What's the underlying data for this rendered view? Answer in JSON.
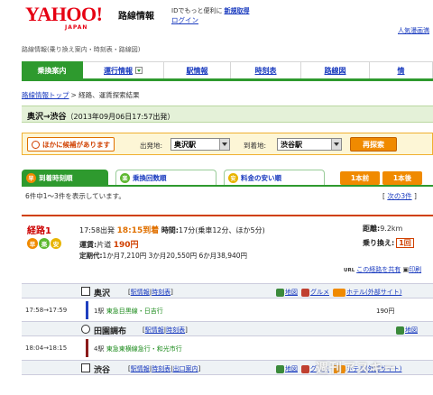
{
  "header": {
    "logo": "YAHOO!",
    "logo_sub": "JAPAN",
    "service": "路線情報",
    "id_text": "IDでもっと便利に",
    "register": "新規取得",
    "login": "ログイン",
    "popular": "人気漫画満"
  },
  "breadcrumb_top": "路線情報(乗り換え案内・時刻表・路線図)",
  "nav": {
    "tabs": [
      {
        "label": "乗換案内",
        "active": true
      },
      {
        "label": "運行情報",
        "dropdown": true
      },
      {
        "label": "駅情報"
      },
      {
        "label": "時刻表"
      },
      {
        "label": "路線図"
      },
      {
        "label": "情"
      }
    ]
  },
  "crumbs": {
    "link": "路線情報トップ",
    "rest": "> 経路、運賃探索結果"
  },
  "route_title": {
    "route": "奥沢→渋谷",
    "date": "（2013年09月06日17:57出発）"
  },
  "search": {
    "alt_badge": "ほかに候補があります",
    "from_label": "出発地:",
    "from_value": "奥沢駅",
    "to_label": "到着地:",
    "to_value": "渋谷駅",
    "button": "再探索"
  },
  "sort_tabs": [
    {
      "icon": "早",
      "label": "到着時刻順",
      "active": true
    },
    {
      "icon": "楽",
      "label": "乗換回数順"
    },
    {
      "icon": "安",
      "label": "料金の安い順"
    }
  ],
  "pager": {
    "prev": "1本前",
    "next": "1本後"
  },
  "result_count": "6件中1～3件を表示しています。",
  "next_results": {
    "open": "[",
    "link": "次の3件",
    "close": "]"
  },
  "route1": {
    "label": "経路1",
    "icons": [
      "早",
      "楽",
      "安"
    ],
    "depart": "17:58出発",
    "arrive": "18:15到着",
    "time_label": "時間:",
    "time_value": "17分(乗車12分、ほか5分)",
    "fare_label": "運賃:",
    "fare_type": "片道",
    "fare_value": "190円",
    "pass_label": "定期代:",
    "pass_value": "1か月7,210円  3か月20,550円  6か月38,940円",
    "distance_label": "距離:",
    "distance_value": "9.2km",
    "transfers_label": "乗り換え:",
    "transfers_value": "1回",
    "share_url": "URL",
    "share": "この経路を共有",
    "print": "印刷"
  },
  "stations": [
    {
      "name": "奥沢",
      "links": [
        "駅情報",
        "時刻表"
      ],
      "extras": [
        "地図",
        "グルメ",
        "ホテル(外部サイト)"
      ]
    },
    {
      "name": "田園調布",
      "links": [
        "駅情報",
        "時刻表"
      ],
      "extras": [
        "地図"
      ]
    },
    {
      "name": "渋谷",
      "links": [
        "駅情報",
        "時刻表",
        "出口案内"
      ],
      "extras": [
        "地図",
        "グルメ",
        "ホテル(外部サイト)"
      ]
    }
  ],
  "segments": [
    {
      "time": "17:58→17:59",
      "track": "1駅",
      "line": "東急目黒線・日吉行",
      "fare": "190円",
      "color": "#1f3fbf"
    },
    {
      "time": "18:04→18:15",
      "track": "4駅",
      "line": "東急東横線急行・和光市行",
      "fare": "",
      "color": "#8a1a1a"
    }
  ],
  "watermark": "週刊アスキー",
  "colors": {
    "accent": "#2e9a2e",
    "orange": "#f08a00",
    "red": "#d04000",
    "link": "#1a3bbf"
  }
}
